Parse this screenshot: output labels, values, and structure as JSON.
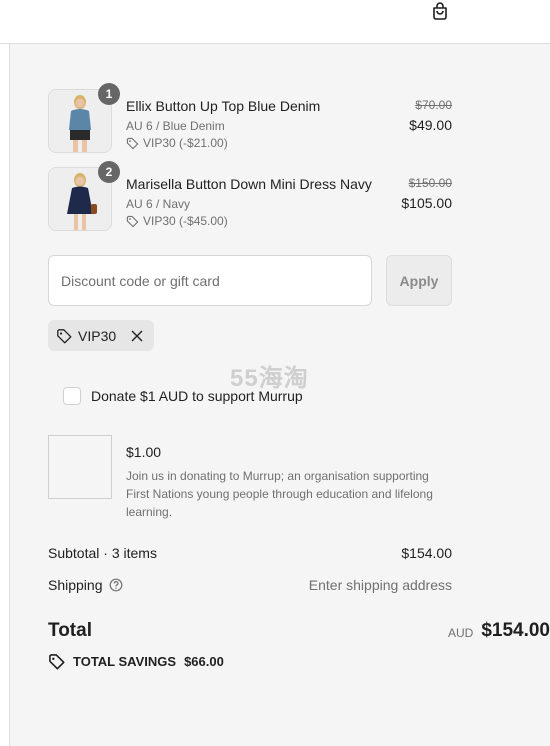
{
  "header": {
    "cart_icon": "shopping-bag-icon"
  },
  "items": [
    {
      "quantity": "1",
      "name": "Ellix Button Up Top Blue Denim",
      "variant": "AU 6 / Blue Denim",
      "discount": "VIP30 (-$21.00)",
      "price_original": "$70.00",
      "price_final": "$49.00",
      "image_colors": {
        "top": "#5b86a8",
        "bottom": "#2a2a2a",
        "skin": "#e8c3a6",
        "hair": "#d7b46a"
      }
    },
    {
      "quantity": "2",
      "name": "Marisella Button Down Mini Dress Navy",
      "variant": "AU 6 / Navy",
      "discount": "VIP30 (-$45.00)",
      "price_original": "$150.00",
      "price_final": "$105.00",
      "image_colors": {
        "top": "#1f2a4a",
        "bottom": "#1f2a4a",
        "skin": "#e8c3a6",
        "hair": "#d7b46a"
      }
    }
  ],
  "discount": {
    "placeholder": "Discount code or gift card",
    "apply_label": "Apply",
    "applied_code": "VIP30"
  },
  "watermark": "55海淘",
  "donation": {
    "checkbox_label": "Donate $1 AUD to support Murrup",
    "checked": false,
    "amount": "$1.00",
    "description": "Join us in donating to Murrup; an organisation supporting First Nations young people through education and lifelong learning."
  },
  "totals": {
    "subtotal_label": "Subtotal · 3 items",
    "subtotal_value": "$154.00",
    "shipping_label": "Shipping",
    "shipping_value": "Enter shipping address",
    "total_label": "Total",
    "currency": "AUD",
    "total_value": "$154.00",
    "savings_label": "TOTAL SAVINGS",
    "savings_value": "$66.00"
  },
  "colors": {
    "summary_bg": "#f5f5f5",
    "text": "#1f1f1f",
    "muted": "#707070",
    "badge": "#666666"
  }
}
